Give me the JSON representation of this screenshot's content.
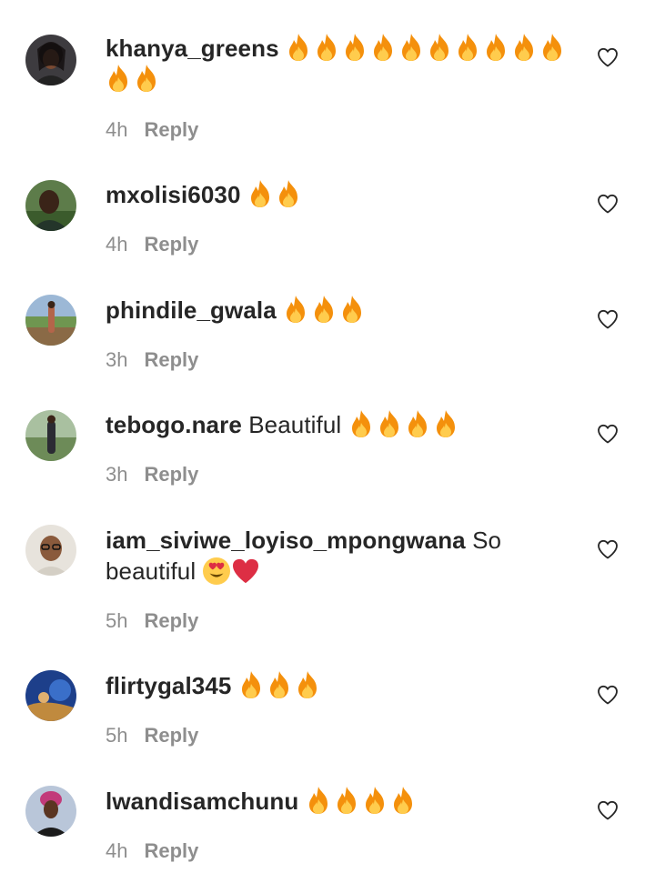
{
  "comments": [
    {
      "username": "khanya_greens",
      "text": "",
      "emoji": "🔥🔥🔥🔥🔥🔥🔥🔥🔥🔥🔥🔥",
      "fire_count": 12,
      "time": "4h",
      "reply": "Reply",
      "avatar": "woman-portrait-avatar"
    },
    {
      "username": "mxolisi6030",
      "text": "",
      "emoji": "🔥🔥",
      "fire_count": 2,
      "time": "4h",
      "reply": "Reply",
      "avatar": "man-green-avatar"
    },
    {
      "username": "phindile_gwala",
      "text": "",
      "emoji": "🔥🔥🔥",
      "fire_count": 3,
      "time": "3h",
      "reply": "Reply",
      "avatar": "outdoor-standing-avatar"
    },
    {
      "username": "tebogo.nare",
      "text": "Beautiful",
      "emoji": "🔥🔥🔥🔥",
      "fire_count": 4,
      "time": "3h",
      "reply": "Reply",
      "avatar": "man-outdoor-avatar"
    },
    {
      "username": "iam_siviwe_loyiso_mpongwana",
      "text": "So beautiful",
      "emoji": "😍❤️",
      "fire_count": 0,
      "time": "5h",
      "reply": "Reply",
      "avatar": "glasses-portrait-avatar"
    },
    {
      "username": "flirtygal345",
      "text": "",
      "emoji": "🔥🔥🔥",
      "fire_count": 3,
      "time": "5h",
      "reply": "Reply",
      "avatar": "blue-art-avatar"
    },
    {
      "username": "lwandisamchunu",
      "text": "",
      "emoji": "🔥🔥🔥🔥",
      "fire_count": 4,
      "time": "4h",
      "reply": "Reply",
      "avatar": "woman-headwrap-avatar"
    }
  ],
  "icons": {
    "like": "heart-outline-icon",
    "fire": "fire-emoji",
    "heart_eyes": "heart-eyes-emoji",
    "red_heart": "red-heart-emoji"
  },
  "colors": {
    "text": "#262626",
    "meta": "#8e8e8e",
    "fire_orange": "#f4900c",
    "fire_yellow": "#ffcc4d",
    "heart_red": "#dd2e44"
  }
}
